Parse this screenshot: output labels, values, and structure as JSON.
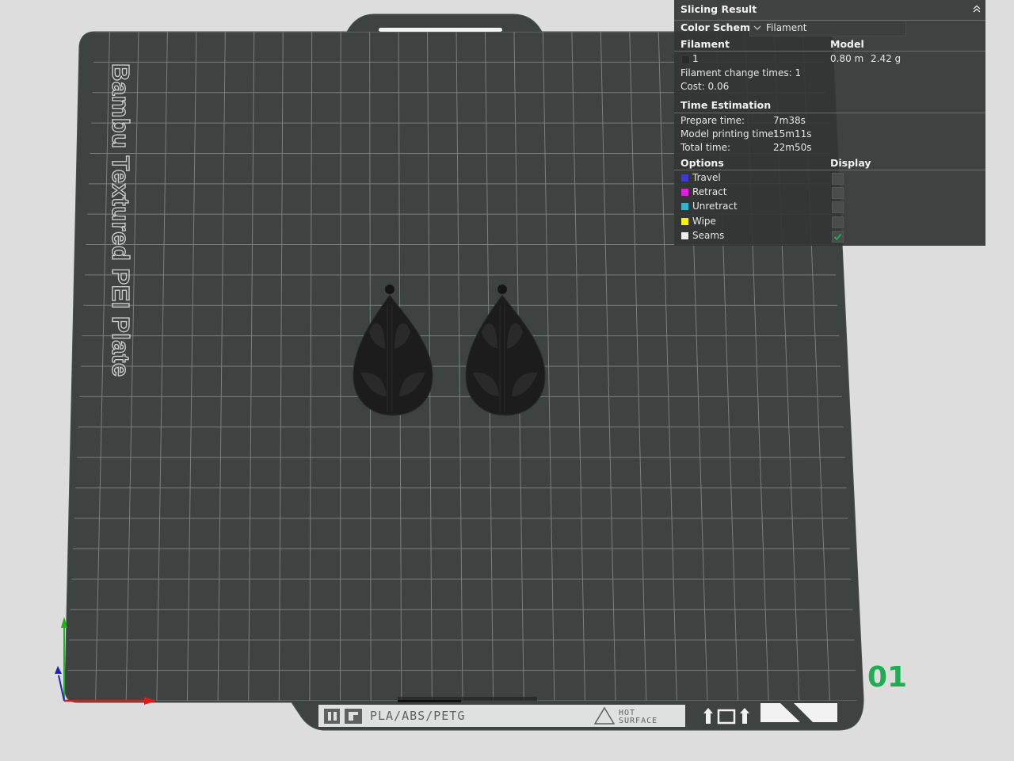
{
  "plate": {
    "title": "Bambu Textured PEI Plate",
    "materials": "PLA/ABS/PETG",
    "hot_surface_line1": "HOT",
    "hot_surface_line2": "SURFACE",
    "plate_number": "01"
  },
  "panel": {
    "title": "Slicing Result",
    "color_scheme_label": "Color Scheme",
    "color_scheme_value": "Filament",
    "filament_header": "Filament",
    "model_header": "Model",
    "filament_index": "1",
    "model_length": "0.80 m",
    "model_weight": "2.42 g",
    "filament_change_times": "Filament change times:  1",
    "cost": "Cost:  0.06",
    "time_header": "Time Estimation",
    "prepare_label": "Prepare time:",
    "prepare_value": "7m38s",
    "model_time_label": "Model printing time:",
    "model_time_value": "15m11s",
    "total_label": "Total time:",
    "total_value": "22m50s",
    "options_header": "Options",
    "display_header": "Display",
    "options": [
      {
        "label": "Travel",
        "color": "#3c3ccc",
        "checked": false
      },
      {
        "label": "Retract",
        "color": "#e01fe0",
        "checked": false
      },
      {
        "label": "Unretract",
        "color": "#33b3cc",
        "checked": false
      },
      {
        "label": "Wipe",
        "color": "#f2f20d",
        "checked": false
      },
      {
        "label": "Seams",
        "color": "#ececec",
        "checked": true
      }
    ]
  }
}
